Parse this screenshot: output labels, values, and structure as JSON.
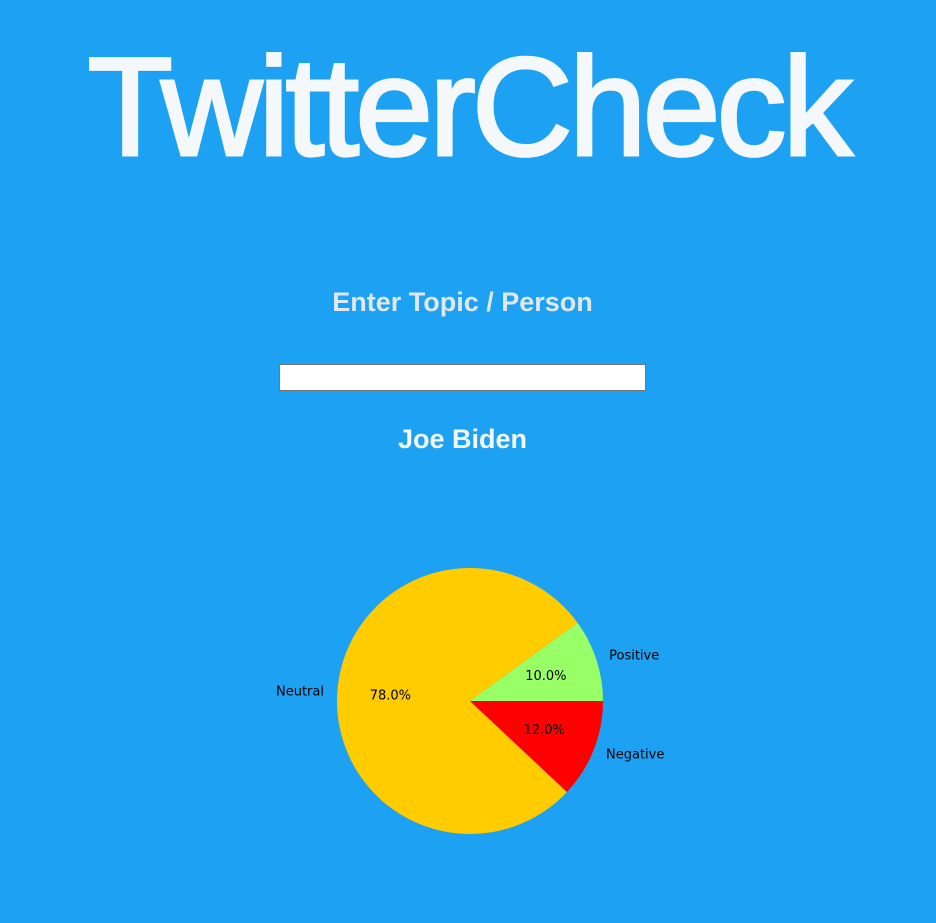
{
  "app": {
    "title": "TwitterCheck"
  },
  "form": {
    "prompt_label": "Enter Topic / Person",
    "search_value": ""
  },
  "result": {
    "topic": "Joe Biden"
  },
  "colors": {
    "background": "#1da1f2",
    "title_text": "#f5f8fa",
    "label_text": "#e1e8ed"
  },
  "chart_data": {
    "type": "pie",
    "start_angle_deg": 0,
    "direction": "counterclockwise",
    "slices": [
      {
        "label": "Positive",
        "value": 10.0,
        "pct_label": "10.0%",
        "color": "#99ff66"
      },
      {
        "label": "Neutral",
        "value": 78.0,
        "pct_label": "78.0%",
        "color": "#ffcc00"
      },
      {
        "label": "Negative",
        "value": 12.0,
        "pct_label": "12.0%",
        "color": "#ff0000"
      }
    ]
  }
}
